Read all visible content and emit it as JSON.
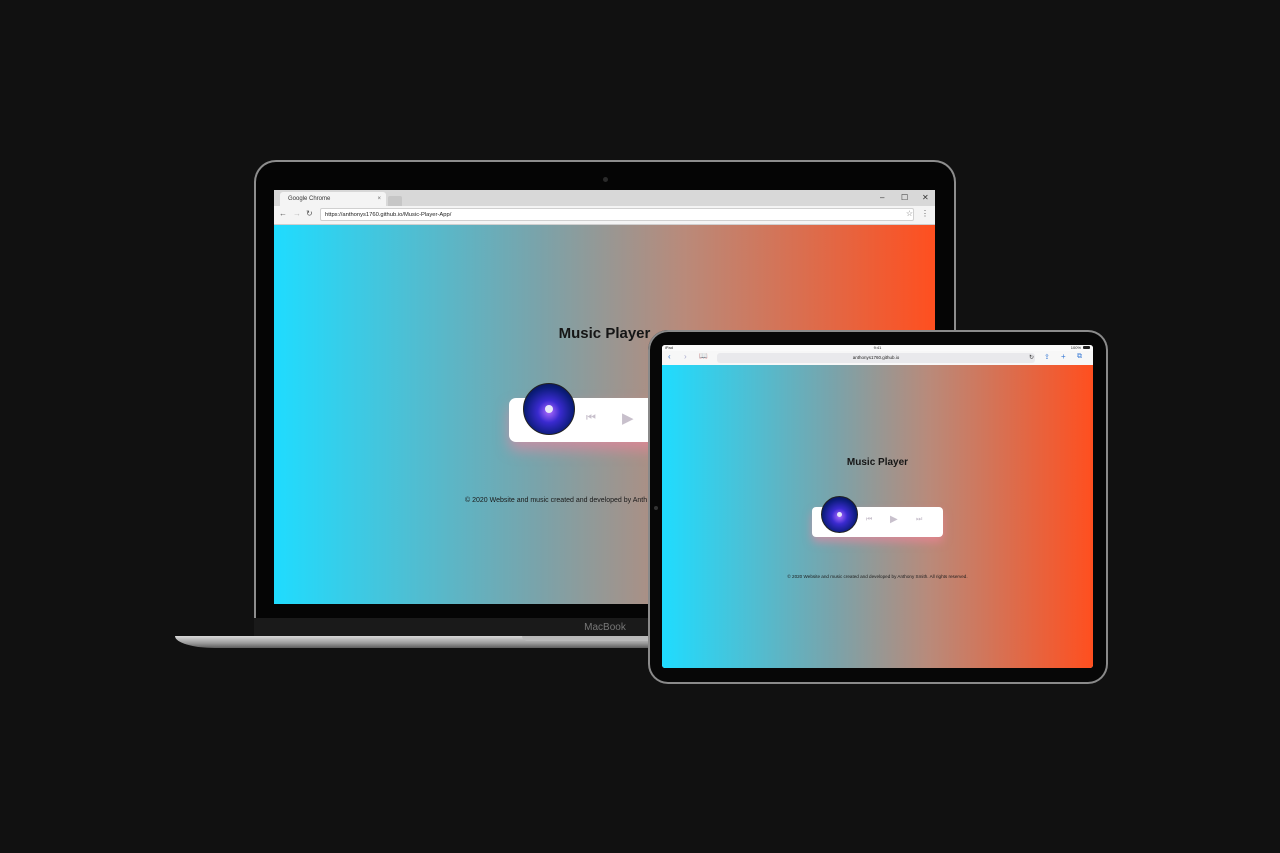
{
  "macbook": {
    "label": "MacBook",
    "browser": {
      "tab_title": "Google Chrome",
      "tab_close": "×",
      "url": "https://anthonys1760.github.io/Music-Player-App/",
      "window_controls": [
        "–",
        "☐",
        "✕"
      ]
    },
    "page": {
      "title": "Music Player",
      "copyright": "© 2020 Website and music created and developed by Anth"
    }
  },
  "ipad": {
    "status": {
      "carrier": "iPad",
      "time": "9:41",
      "battery": "100%"
    },
    "browser": {
      "url": "anthonys1760.github.io"
    },
    "page": {
      "title": "Music Player",
      "copyright": "© 2020 Website and music created and developed by Anthony Smith. All rights reserved."
    }
  },
  "icons": {
    "prev": "⏮",
    "play": "▶",
    "next": "⏭"
  },
  "colors": {
    "gradient_left": "#1fdcff",
    "gradient_right": "#ff4f1f",
    "background": "#111111"
  }
}
